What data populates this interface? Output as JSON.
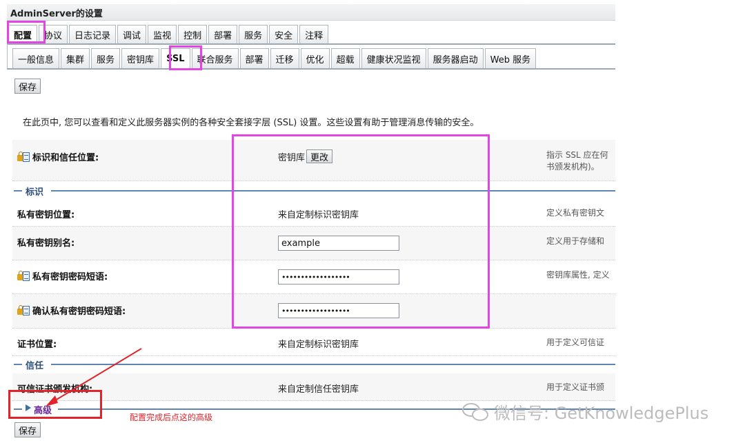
{
  "window": {
    "title": "AdminServer的设置"
  },
  "primary_tabs": [
    {
      "label": "配置",
      "active": true
    },
    {
      "label": "协议"
    },
    {
      "label": "日志记录"
    },
    {
      "label": "调试"
    },
    {
      "label": "监视"
    },
    {
      "label": "控制"
    },
    {
      "label": "部署"
    },
    {
      "label": "服务"
    },
    {
      "label": "安全"
    },
    {
      "label": "注释"
    }
  ],
  "secondary_tabs": [
    {
      "label": "一般信息"
    },
    {
      "label": "集群"
    },
    {
      "label": "服务"
    },
    {
      "label": "密钥库"
    },
    {
      "label": "SSL",
      "active": true
    },
    {
      "label": "联合服务"
    },
    {
      "label": "部署"
    },
    {
      "label": "迁移"
    },
    {
      "label": "优化"
    },
    {
      "label": "超载"
    },
    {
      "label": "健康状况监视"
    },
    {
      "label": "服务器启动"
    },
    {
      "label": "Web 服务"
    }
  ],
  "toolbar": {
    "save_label": "保存"
  },
  "description": "在此页中, 您可以查看和定义此服务器实例的各种安全套接字层 (SSL) 设置。这些设置有助于管理消息传输的安全。",
  "identity_trust": {
    "label": "标识和信任位置:",
    "value": "密钥库",
    "change_label": "更改",
    "help_line1": "指示 SSL 应在何",
    "help_line2": "书颁发机构)。"
  },
  "sections": {
    "identity": "标识",
    "trust": "信任",
    "advanced": "高级"
  },
  "private_key_location": {
    "label": "私有密钥位置:",
    "value": "来自定制标识密钥库",
    "help": "定义私有密钥文"
  },
  "private_key_alias": {
    "label": "私有密钥别名:",
    "value": "example",
    "help": "定义用于存储和"
  },
  "private_key_passphrase": {
    "label": "私有密钥密码短语:",
    "value": "••••••••••••••••••",
    "help": "密钥库属性, 定义"
  },
  "confirm_passphrase": {
    "label": "确认私有密钥密码短语:",
    "value": "••••••••••••••••••"
  },
  "certificate_location": {
    "label": "证书位置:",
    "value": "来自定制标识密钥库",
    "help": "用于定义可信证"
  },
  "trusted_ca": {
    "label": "可信证书颁发机构:",
    "value": "来自定制信任密钥库",
    "help": "用于定义证书颁"
  },
  "annotation": {
    "text": "配置完成后点这的高级"
  },
  "watermark": {
    "text": "微信号: GetKnowledgePlus"
  },
  "colors": {
    "highlight_magenta": "#e344e6",
    "annotation_red": "#e0242a",
    "section_blue": "#5d84b3"
  }
}
